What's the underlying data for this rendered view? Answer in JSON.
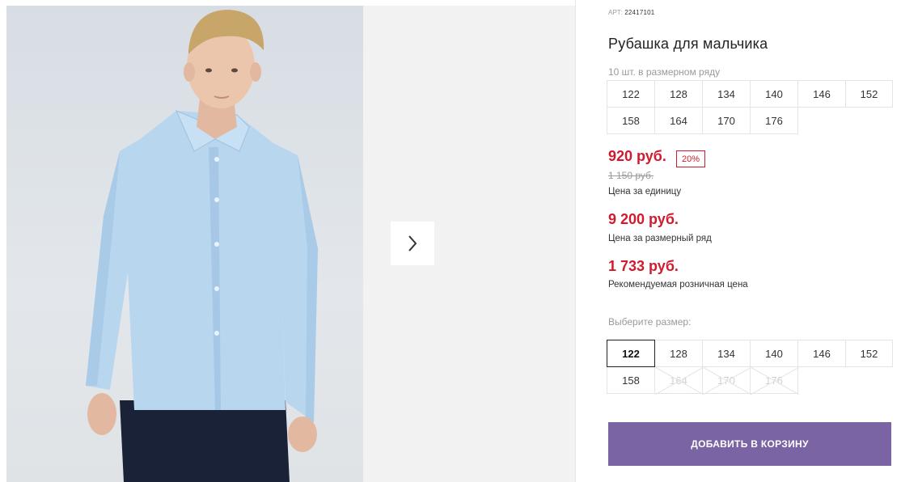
{
  "product": {
    "art_label": "АРТ:",
    "art_value": "22417101",
    "title": "Рубашка для мальчика",
    "row_count_text": "10 шт. в размерном ряду"
  },
  "size_range": [
    "122",
    "128",
    "134",
    "140",
    "146",
    "152",
    "158",
    "164",
    "170",
    "176"
  ],
  "prices": {
    "unit_price": "920 руб.",
    "discount_badge": "20%",
    "old_price": "1 150 руб.",
    "unit_caption": "Цена за единицу",
    "row_price": "9 200 руб.",
    "row_caption": "Цена за размерный ряд",
    "retail_price": "1 733 руб.",
    "retail_caption": "Рекомендуемая розничная цена"
  },
  "size_select": {
    "label": "Выберите размер:",
    "options": [
      {
        "size": "122",
        "state": "selected"
      },
      {
        "size": "128",
        "state": "available"
      },
      {
        "size": "134",
        "state": "available"
      },
      {
        "size": "140",
        "state": "available"
      },
      {
        "size": "146",
        "state": "available"
      },
      {
        "size": "152",
        "state": "available"
      },
      {
        "size": "158",
        "state": "available"
      },
      {
        "size": "164",
        "state": "unavailable"
      },
      {
        "size": "170",
        "state": "unavailable"
      },
      {
        "size": "176",
        "state": "unavailable"
      }
    ]
  },
  "cart_button": "ДОБАВИТЬ В КОРЗИНУ",
  "gallery": {
    "next_icon": "chevron-right-icon"
  },
  "colors": {
    "price_red": "#d01a2e",
    "button_purple": "#7b64a3",
    "shirt_blue": "#b9d6ef"
  }
}
